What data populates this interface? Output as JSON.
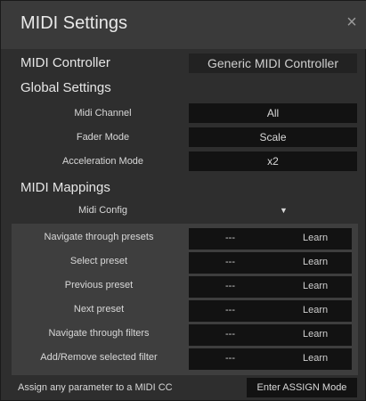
{
  "window": {
    "title": "MIDI Settings",
    "close_icon": "×"
  },
  "controller": {
    "label": "MIDI Controller",
    "value": "Generic MIDI Controller"
  },
  "global": {
    "heading": "Global Settings",
    "rows": [
      {
        "label": "Midi Channel",
        "value": "All"
      },
      {
        "label": "Fader Mode",
        "value": "Scale"
      },
      {
        "label": "Acceleration Mode",
        "value": "x2"
      }
    ]
  },
  "mappings": {
    "heading": "MIDI Mappings",
    "config_label": "Midi Config",
    "config_arrow": "▼",
    "rows": [
      {
        "label": "Navigate through presets",
        "cc": "---",
        "learn": "Learn"
      },
      {
        "label": "Select preset",
        "cc": "---",
        "learn": "Learn"
      },
      {
        "label": "Previous preset",
        "cc": "---",
        "learn": "Learn"
      },
      {
        "label": "Next preset",
        "cc": "---",
        "learn": "Learn"
      },
      {
        "label": "Navigate through filters",
        "cc": "---",
        "learn": "Learn"
      },
      {
        "label": "Add/Remove selected filter",
        "cc": "---",
        "learn": "Learn"
      }
    ]
  },
  "footer": {
    "text": "Assign any parameter to a MIDI CC",
    "button": "Enter ASSIGN Mode"
  }
}
